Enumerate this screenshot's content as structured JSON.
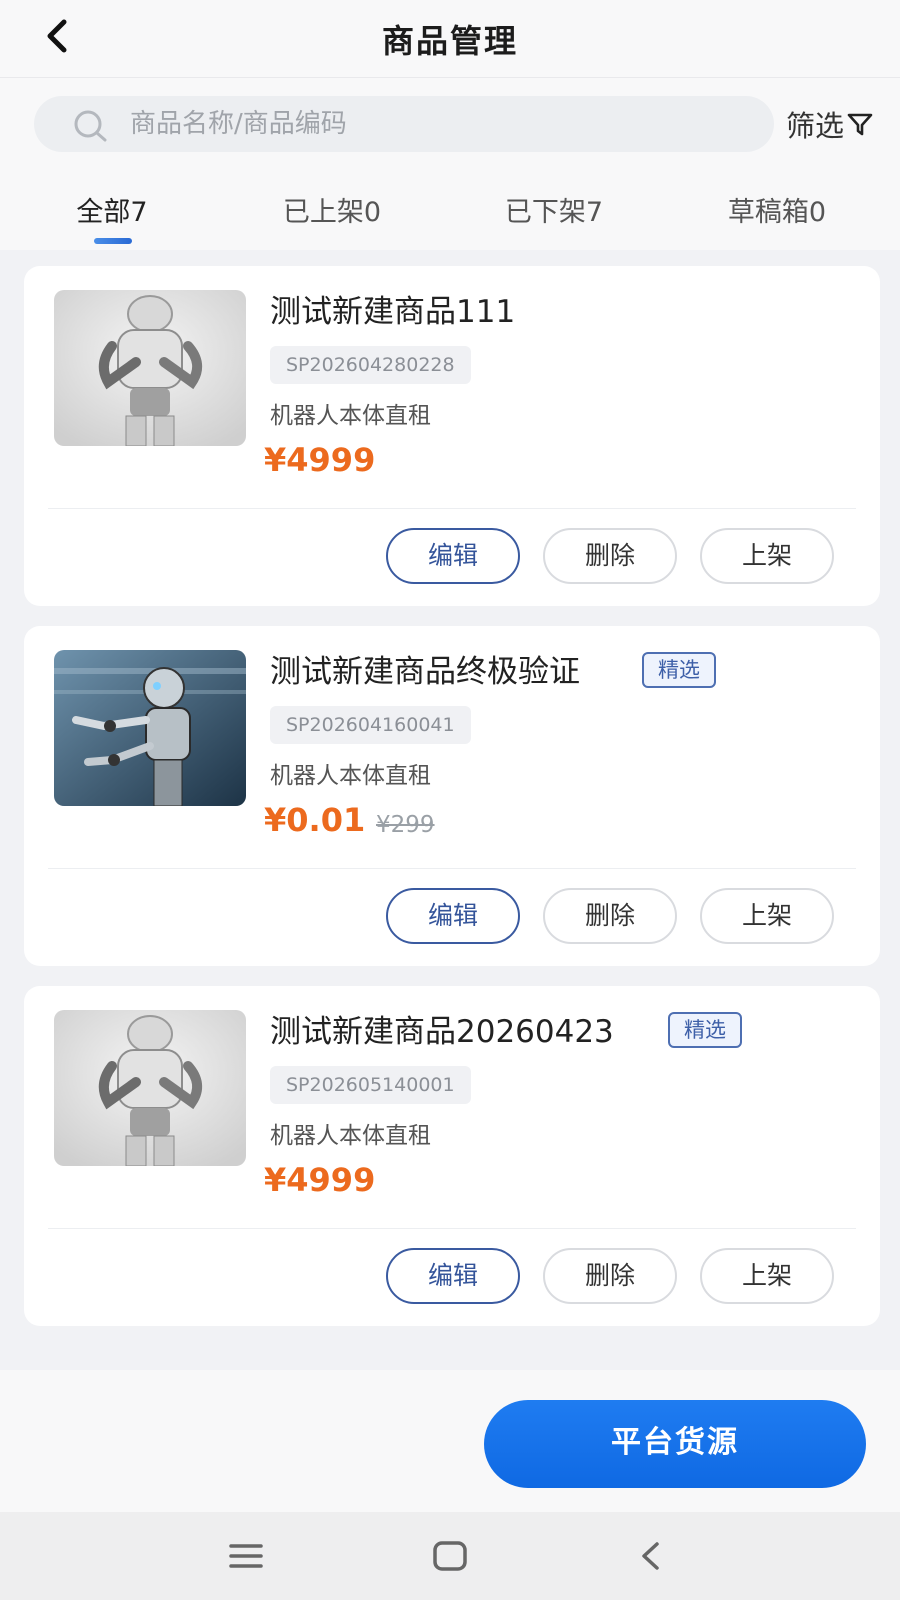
{
  "header": {
    "title": "商品管理"
  },
  "search": {
    "placeholder": "商品名称/商品编码",
    "filter_label": "筛选"
  },
  "tabs": [
    {
      "label": "全部7",
      "active": true
    },
    {
      "label": "已上架0",
      "active": false
    },
    {
      "label": "已下架7",
      "active": false
    },
    {
      "label": "草稿箱0",
      "active": false
    }
  ],
  "products": [
    {
      "name": "测试新建商品111",
      "featured": false,
      "code": "SP202604280228",
      "category": "机器人本体直租",
      "price": "¥4999",
      "original_price": null,
      "image": "robot-gray-icon"
    },
    {
      "name": "测试新建商品终极验证",
      "featured": true,
      "featured_label": "精选",
      "code": "SP202604160041",
      "category": "机器人本体直租",
      "price": "¥0.01",
      "original_price": "¥299",
      "image": "robot-lab-icon"
    },
    {
      "name": "测试新建商品20260423",
      "featured": true,
      "featured_label": "精选",
      "code": "SP202605140001",
      "category": "机器人本体直租",
      "price": "¥4999",
      "original_price": null,
      "image": "robot-gray-icon"
    }
  ],
  "actions": {
    "edit": "编辑",
    "delete": "删除",
    "list": "上架"
  },
  "bottom": {
    "platform_button": "平台货源"
  },
  "colors": {
    "accent": "#1a73ee",
    "price": "#ec6a1e",
    "edit_border": "#3a5aa0"
  }
}
